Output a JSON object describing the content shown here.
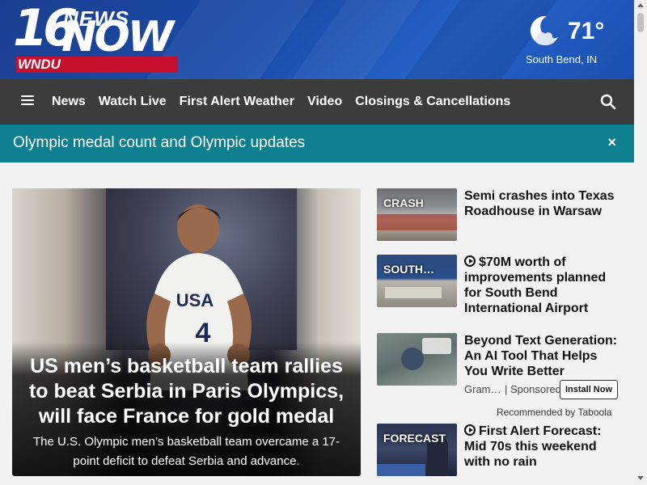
{
  "header": {
    "logo": {
      "number": "16",
      "news": "NEWS",
      "now": "NOW",
      "station": "WNDU"
    },
    "weather": {
      "icon": "moon-cloud-icon",
      "temperature": "71°",
      "location": "South Bend, IN"
    }
  },
  "nav": {
    "menu_icon": "hamburger-menu-icon",
    "items": [
      "News",
      "Watch Live",
      "First Alert Weather",
      "Video",
      "Closings & Cancellations"
    ],
    "search_icon": "search-icon"
  },
  "alert": {
    "text": "Olympic medal count and Olympic updates",
    "close": "×"
  },
  "hero": {
    "headline": "US men’s basketball team rallies to beat Serbia in Paris Olympics, will face France for gold medal",
    "summary": "The U.S. Olympic men’s basketball team overcame a 17-point deficit to defeat Serbia and advance.",
    "jersey_text": "USA",
    "jersey_number": "4"
  },
  "stories": [
    {
      "label": "CRASH",
      "title": "Semi crashes into Texas Roadhouse in Warsaw",
      "video": false
    },
    {
      "label": "SOUTH…",
      "title": "$70M worth of improvements planned for South Bend International Airport",
      "video": true
    },
    {
      "label": "",
      "title": "Beyond Text Generation: An AI Tool That Helps You Write Better",
      "video": false,
      "sponsored": {
        "source": "Gram…",
        "tag": "| Sponsored",
        "button": "Install Now"
      }
    },
    {
      "label": "FORECAST",
      "title": "First Alert Forecast: Mid 70s this weekend with no rain",
      "video": true
    }
  ],
  "recommended": "Recommended by Taboola",
  "colors": {
    "header_blue": "#1a4aa8",
    "nav_bg": "#3c3c3c",
    "alert_teal": "#0e7f8e",
    "logo_red": "#c8102e"
  }
}
